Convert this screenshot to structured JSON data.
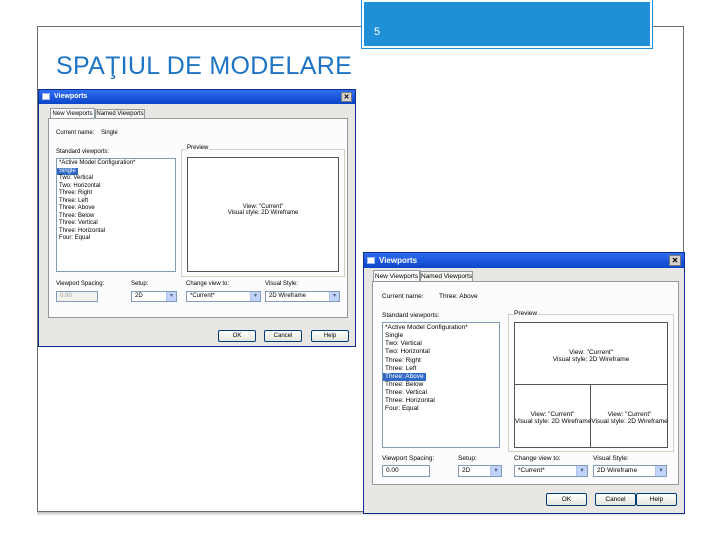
{
  "slide": {
    "page_number": "5",
    "title": "SPAŢIUL DE MODELARE",
    "colors": {
      "badge": "#1f8fd8",
      "title": "#1e74c4"
    }
  },
  "dialog1": {
    "title": "Viewports",
    "close_glyph": "✕",
    "tabs": [
      "New Viewports",
      "Named Viewports"
    ],
    "current_name_label": "Current name:",
    "current_name_value": "Single",
    "standard_viewports_label": "Standard viewports:",
    "standard_viewports": [
      "*Active Model Configuration*",
      "Single",
      "Two: Vertical",
      "Two: Horizontal",
      "Three: Right",
      "Three: Left",
      "Three: Above",
      "Three: Below",
      "Three: Vertical",
      "Three: Horizontal",
      "Four: Equal"
    ],
    "selected_index": 1,
    "preview_label": "Preview",
    "preview_view_text": "View: \"Current\"",
    "preview_style_text": "Visual style: 2D Wireframe",
    "viewport_spacing_label": "Viewport Spacing:",
    "viewport_spacing_value": "0.00",
    "setup_label": "Setup:",
    "setup_value": "2D",
    "change_view_label": "Change view to:",
    "change_view_value": "*Current*",
    "visual_style_label": "Visual Style:",
    "visual_style_value": "2D Wireframe",
    "buttons": [
      "OK",
      "Cancel",
      "Help"
    ],
    "arrow_glyph": "▾"
  },
  "dialog2": {
    "title": "Viewports",
    "close_glyph": "✕",
    "tabs": [
      "New Viewports",
      "Named Viewports"
    ],
    "current_name_label": "Current name:",
    "current_name_value": "Three: Above",
    "standard_viewports_label": "Standard viewports:",
    "standard_viewports": [
      "*Active Model Configuration*",
      "Single",
      "Two: Vertical",
      "Two: Horizontal",
      "Three: Right",
      "Three: Left",
      "Three: Above",
      "Three: Below",
      "Three: Vertical",
      "Three: Horizontal",
      "Four: Equal"
    ],
    "selected_index": 6,
    "preview_label": "Preview",
    "viewport_top_view": "View: \"Current\"",
    "viewport_top_style": "Visual style: 2D Wireframe",
    "viewport_bottom_left_view": "View: \"Current\"",
    "viewport_bottom_left_style": "Visual style: 2D Wireframe",
    "viewport_bottom_right_view": "View: \"Current\"",
    "viewport_bottom_right_style": "Visual style: 2D Wireframe",
    "viewport_spacing_label": "Viewport Spacing:",
    "viewport_spacing_value": "0.00",
    "setup_label": "Setup:",
    "setup_value": "2D",
    "change_view_label": "Change view to:",
    "change_view_value": "*Current*",
    "visual_style_label": "Visual Style:",
    "visual_style_value": "2D Wireframe",
    "buttons": [
      "OK",
      "Cancel",
      "Help"
    ],
    "arrow_glyph": "▾"
  }
}
